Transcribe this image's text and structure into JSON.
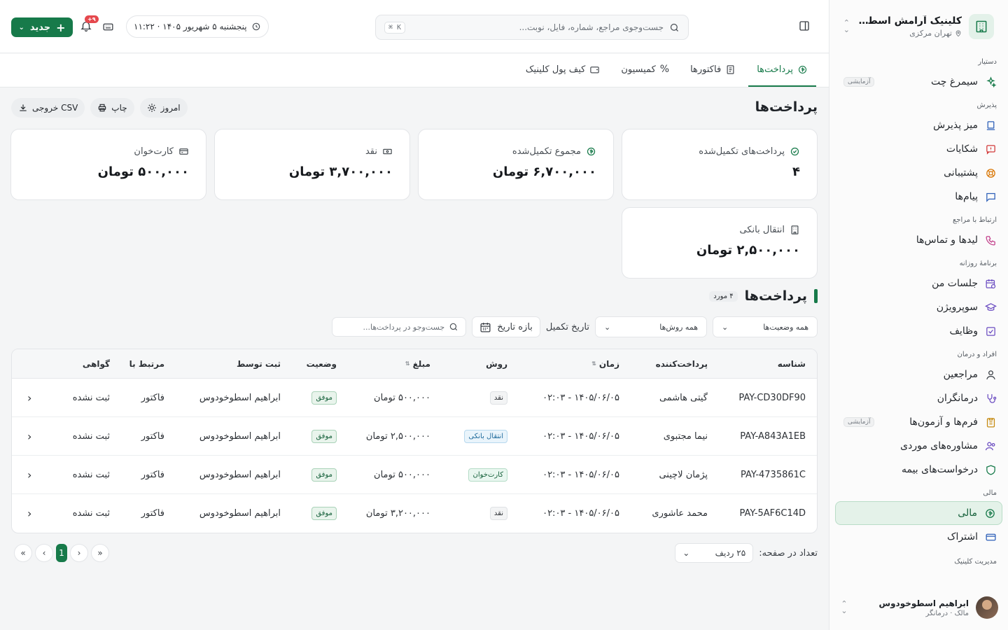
{
  "sidebar": {
    "clinic_name": "کلینیک آرامش اسطوخو...",
    "clinic_location": "تهران مرکزی",
    "sections": {
      "assistant": "دستیار",
      "reception": "پذیرش",
      "contact": "ارتباط با مراجع",
      "daily": "برنامهٔ روزانه",
      "people": "افراد و درمان",
      "finance": "مالی",
      "management": "مدیریت کلینیک"
    },
    "items": {
      "simorgh": "سیمرغ چت",
      "simorgh_badge": "آزمایشی",
      "desk": "میز پذیرش",
      "complaints": "شکایات",
      "support": "پشتیبانی",
      "messages": "پیام‌ها",
      "leads": "لیدها و تماس‌ها",
      "sessions": "جلسات من",
      "supervision": "سوپرویژن",
      "tasks": "وظایف",
      "clients": "مراجعین",
      "therapists": "درمانگران",
      "forms": "فرم‌ها و آزمون‌ها",
      "forms_badge": "آزمایشی",
      "cases": "مشاوره‌های موردی",
      "insurance": "درخواست‌های بیمه",
      "finance": "مالی",
      "subscription": "اشتراک"
    },
    "user": {
      "name": "ابراهیم اسطوخودوس",
      "role": "مالک · درمانگر"
    }
  },
  "topbar": {
    "search_placeholder": "جست‌وجوی مراجع، شماره، فایل، نوبت...",
    "shortcut": "⌘ K",
    "date": "پنجشنبه ۵ شهریور ۱۴۰۵ · ۱۱:۲۲",
    "notif_count": "۹+",
    "new_label": "جدید"
  },
  "tabs": [
    {
      "label": "پرداخت‌ها",
      "active": true
    },
    {
      "label": "فاکتورها",
      "active": false
    },
    {
      "label": "کمیسیون",
      "active": false
    },
    {
      "label": "کیف پول کلینیک",
      "active": false
    }
  ],
  "page": {
    "title": "پرداخت‌ها",
    "actions": {
      "today": "امروز",
      "print": "چاپ",
      "export": "خروجی CSV"
    }
  },
  "stats": [
    {
      "label": "پرداخت‌های تکمیل‌شده",
      "value": "۴",
      "icon": "check-circle-icon"
    },
    {
      "label": "مجموع تکمیل‌شده",
      "value": "۶,۷۰۰,۰۰۰ تومان",
      "icon": "money-icon"
    },
    {
      "label": "نقد",
      "value": "۳,۷۰۰,۰۰۰ تومان",
      "icon": "cash-icon"
    },
    {
      "label": "کارت‌خوان",
      "value": "۵۰۰,۰۰۰ تومان",
      "icon": "card-icon"
    },
    {
      "label": "انتقال بانکی",
      "value": "۲,۵۰۰,۰۰۰ تومان",
      "icon": "bank-icon"
    }
  ],
  "section": {
    "title": "پرداخت‌ها",
    "count": "۴ مورد"
  },
  "filters": {
    "status": "همه وضعیت‌ها",
    "method": "همه روش‌ها",
    "date_label": "تاریخ تکمیل",
    "date_range": "بازه تاریخ",
    "search_placeholder": "جست‌وجو در پرداخت‌ها..."
  },
  "table": {
    "headers": {
      "id": "شناسه",
      "payer": "پرداخت‌کننده",
      "time": "زمان",
      "method": "روش",
      "amount": "مبلغ",
      "status": "وضعیت",
      "by": "ثبت توسط",
      "linked": "مرتبط با",
      "cert": "گواهی"
    },
    "rows": [
      {
        "id": "PAY-CD30DF90",
        "payer": "گیتی هاشمی",
        "time": "۱۴۰۵/۰۶/۰۵ - ۰۲:۰۳",
        "method": "نقد",
        "method_type": "cash",
        "amount": "۵۰۰,۰۰۰ تومان",
        "status": "موفق",
        "by": "ابراهیم اسطوخودوس",
        "linked": "فاکتور",
        "cert": "ثبت نشده"
      },
      {
        "id": "PAY-A843A1EB",
        "payer": "نیما مجتبوی",
        "time": "۱۴۰۵/۰۶/۰۵ - ۰۲:۰۳",
        "method": "انتقال بانکی",
        "method_type": "bank",
        "amount": "۲,۵۰۰,۰۰۰ تومان",
        "status": "موفق",
        "by": "ابراهیم اسطوخودوس",
        "linked": "فاکتور",
        "cert": "ثبت نشده"
      },
      {
        "id": "PAY-4735861C",
        "payer": "پژمان لاچینی",
        "time": "۱۴۰۵/۰۶/۰۵ - ۰۲:۰۳",
        "method": "کارت‌خوان",
        "method_type": "card",
        "amount": "۵۰۰,۰۰۰ تومان",
        "status": "موفق",
        "by": "ابراهیم اسطوخودوس",
        "linked": "فاکتور",
        "cert": "ثبت نشده"
      },
      {
        "id": "PAY-5AF6C14D",
        "payer": "محمد عاشوری",
        "time": "۱۴۰۵/۰۶/۰۵ - ۰۲:۰۳",
        "method": "نقد",
        "method_type": "cash",
        "amount": "۳,۲۰۰,۰۰۰ تومان",
        "status": "موفق",
        "by": "ابراهیم اسطوخودوس",
        "linked": "فاکتور",
        "cert": "ثبت نشده"
      }
    ]
  },
  "pagination": {
    "per_page_label": "تعداد در صفحه:",
    "per_page_value": "۲۵ ردیف",
    "current": "1"
  },
  "colors": {
    "primary": "#177a4a",
    "active_bg": "#e4f2e9",
    "danger": "#e5484d"
  }
}
